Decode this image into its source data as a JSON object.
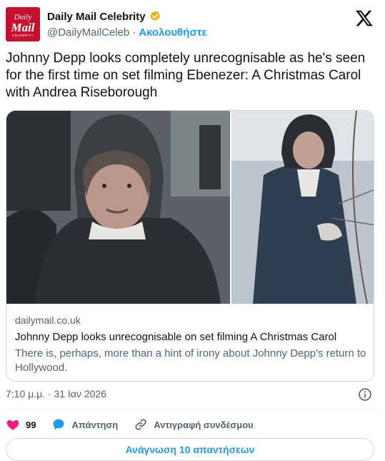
{
  "author": {
    "avatar_text": [
      "Daily",
      "Mail",
      "CELEBRITY"
    ],
    "display_name": "Daily Mail Celebrity",
    "handle": "@DailyMailCeleb",
    "separator": "·",
    "follow_label": "Ακολουθήστε",
    "verified_color": "#e2b719"
  },
  "tweet": {
    "text": "Johnny Depp looks completely unrecognisable as he's seen for the first time on set filming Ebenezer: A Christmas Carol with Andrea Riseborough"
  },
  "card": {
    "domain": "dailymail.co.uk",
    "title": "Johnny Depp looks unrecognisable on set filming A Christmas Carol",
    "description": "There is, perhaps, more than a hint of irony about Johnny Depp's return to Hollywood."
  },
  "meta": {
    "timestamp": "7:10 μ.μ. · 31 Ιαν 2026"
  },
  "actions": {
    "like_count": "99",
    "reply_label": "Απάντηση",
    "copy_link_label": "Αντιγραφή συνδέσμου"
  },
  "footer": {
    "read_replies_label": "Ανάγνωση 10 απαντήσεων"
  },
  "colors": {
    "accent": "#1d9bf0",
    "like": "#f91880",
    "brand": "#c8102e"
  }
}
